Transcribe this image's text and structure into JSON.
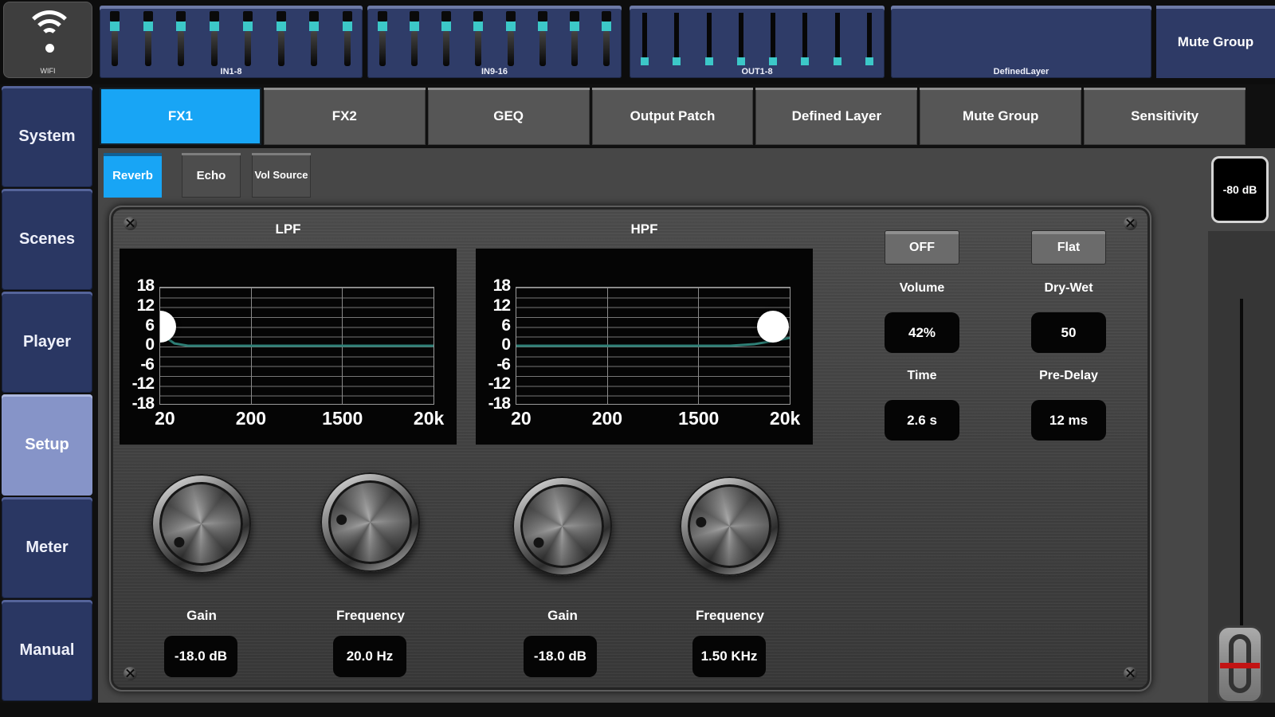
{
  "colors": {
    "accent_blue": "#18a5f5",
    "sidebar_navy": "#2a3763",
    "sidebar_active": "#8694c8",
    "bank_navy": "#2f3c68",
    "curve_teal": "#2e7f76",
    "fader_cyan": "#3cc8c8",
    "handle_red": "#c21414"
  },
  "topbar": {
    "wifi_label": "WIFI",
    "banks": [
      {
        "label": "IN1-8"
      },
      {
        "label": "IN9-16"
      },
      {
        "label": "OUT1-8"
      },
      {
        "label": "DefinedLayer"
      }
    ],
    "mute_group": "Mute Group"
  },
  "tabs": [
    {
      "label": "FX1",
      "active": true
    },
    {
      "label": "FX2",
      "active": false
    },
    {
      "label": "GEQ",
      "active": false
    },
    {
      "label": "Output Patch",
      "active": false
    },
    {
      "label": "Defined Layer",
      "active": false
    },
    {
      "label": "Mute Group",
      "active": false
    },
    {
      "label": "Sensitivity",
      "active": false
    }
  ],
  "subtabs": [
    {
      "label": "Reverb",
      "active": true
    },
    {
      "label": "Echo",
      "active": false
    },
    {
      "label": "Vol Source",
      "active": false
    }
  ],
  "sidebar": [
    {
      "label": "System",
      "active": false
    },
    {
      "label": "Scenes",
      "active": false
    },
    {
      "label": "Player",
      "active": false
    },
    {
      "label": "Setup",
      "active": true
    },
    {
      "label": "Meter",
      "active": false
    },
    {
      "label": "Manual",
      "active": false
    }
  ],
  "fx": {
    "graphs": [
      {
        "title": "LPF",
        "y_ticks": [
          "18",
          "12",
          "6",
          "0",
          "-6",
          "-12",
          "-18"
        ],
        "x_ticks": [
          "20",
          "200",
          "1500",
          "20k"
        ],
        "handle_position": "left",
        "handle_db": 6
      },
      {
        "title": "HPF",
        "y_ticks": [
          "18",
          "12",
          "6",
          "0",
          "-6",
          "-12",
          "-18"
        ],
        "x_ticks": [
          "20",
          "200",
          "1500",
          "20k"
        ],
        "handle_position": "right",
        "handle_db": 6
      }
    ],
    "bypass_button": "OFF",
    "flat_button": "Flat",
    "params": [
      {
        "label": "Volume",
        "value": "42%"
      },
      {
        "label": "Time",
        "value": "2.6 s"
      },
      {
        "label": "Dry-Wet",
        "value": "50"
      },
      {
        "label": "Pre-Delay",
        "value": "12 ms"
      }
    ],
    "knobs": [
      {
        "label": "Gain",
        "value": "-18.0 dB",
        "dot_angle": "-40deg"
      },
      {
        "label": "Frequency",
        "value": "20.0 Hz",
        "dot_angle": "5deg"
      },
      {
        "label": "Gain",
        "value": "-18.0 dB",
        "dot_angle": "-35deg"
      },
      {
        "label": "Frequency",
        "value": "1.50 KHz",
        "dot_angle": "8deg"
      }
    ]
  },
  "master": {
    "level": "-80 dB"
  }
}
